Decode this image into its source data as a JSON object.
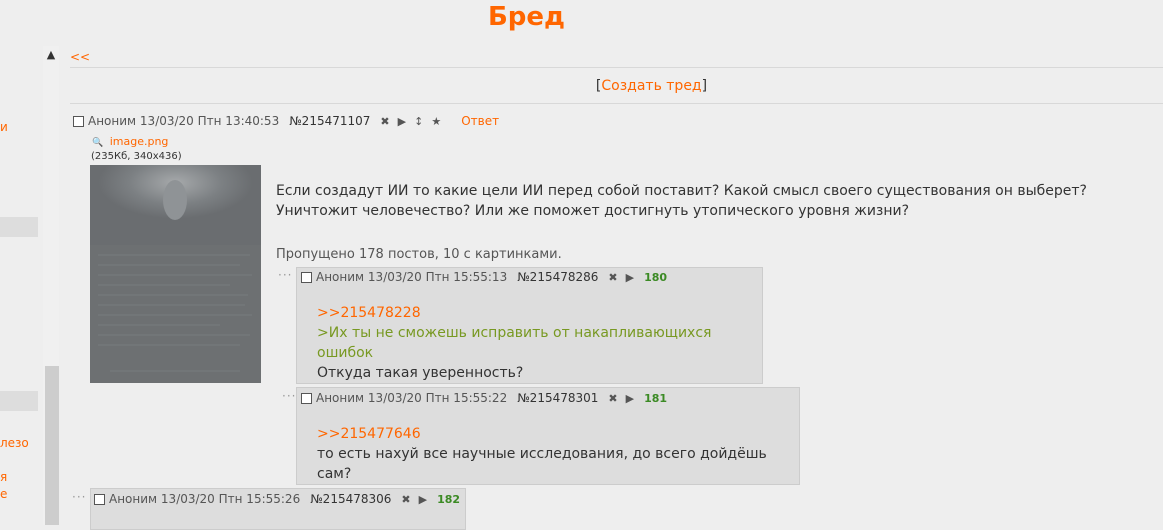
{
  "board_title": "Бред",
  "back_link": "<<",
  "create_thread": {
    "open": "[",
    "label": "Создать тред",
    "close": "]"
  },
  "sidebar": {
    "items": [
      "и",
      "лезо",
      "я",
      "е"
    ]
  },
  "op": {
    "author": "Аноним",
    "date": "13/03/20 Птн 13:40:53",
    "number": "№215471107",
    "reply_label": "Ответ",
    "file_name": "image.png",
    "file_info": "(235Кб, 340x436)",
    "text": "Если создадут ИИ то какие цели ИИ перед собой поставит? Какой смысл своего существования он выберет? Уничтожит человечество? Или же поможет достигнуть утопического уровня жизни?",
    "omitted": "Пропущено 178 постов, 10 с картинками."
  },
  "replies": [
    {
      "author": "Аноним",
      "date": "13/03/20 Птн 15:55:13",
      "number": "№215478286",
      "count": "180",
      "ref": ">>215478228",
      "quote": ">Их ты не сможешь исправить от накапливающихся ошибок",
      "text": "Откуда такая уверенность?"
    },
    {
      "author": "Аноним",
      "date": "13/03/20 Птн 15:55:22",
      "number": "№215478301",
      "count": "181",
      "ref": ">>215477646",
      "text": "то есть нахуй все научные исследования, до всего дойдёшь сам?"
    },
    {
      "author": "Аноним",
      "date": "13/03/20 Птн 15:55:26",
      "number": "№215478306",
      "count": "182"
    }
  ],
  "icons": {
    "hide": "✖",
    "play": "▶",
    "sort": "↕",
    "star": "★",
    "search": "🔍",
    "dots": "···",
    "scroll_up": "▲"
  },
  "colors": {
    "accent": "#ff6600",
    "quote": "#789922",
    "count": "#3b8a24",
    "background": "#eeeeee",
    "reply_bg": "#dddddd"
  }
}
